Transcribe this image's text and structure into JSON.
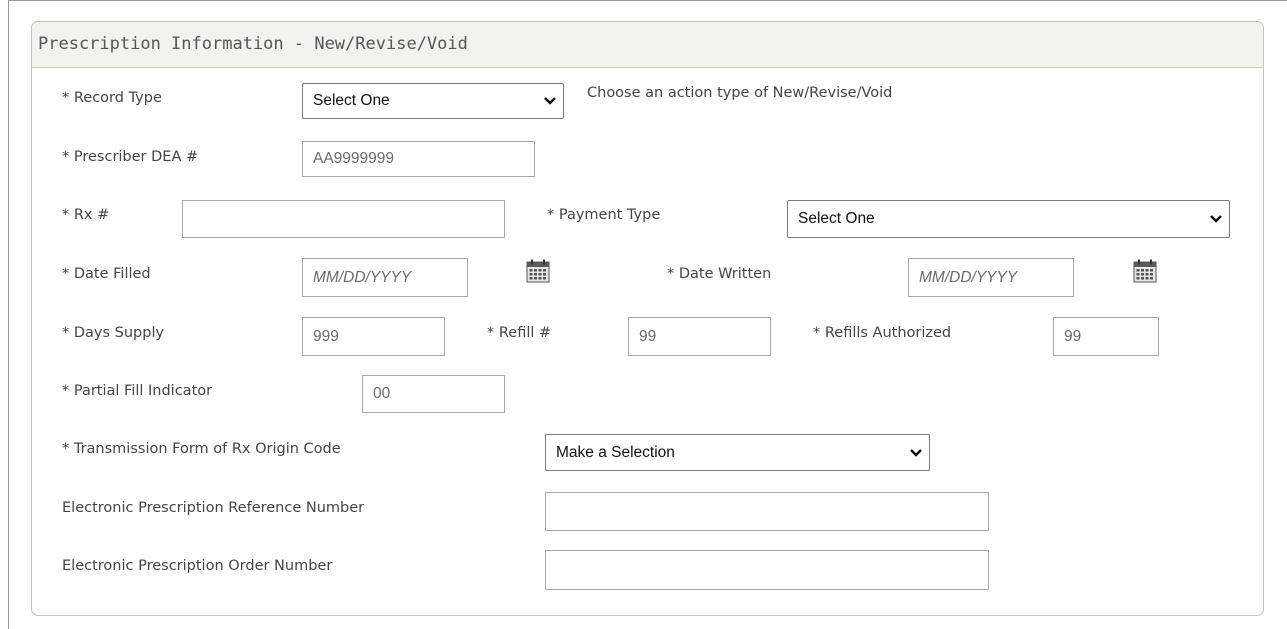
{
  "panel": {
    "title": "Prescription Information - New/Revise/Void"
  },
  "record_type": {
    "label": "* Record Type",
    "value": "Select One",
    "hint": "Choose an action type of New/Revise/Void"
  },
  "prescriber_dea": {
    "label": "* Prescriber DEA #",
    "placeholder": "AA9999999"
  },
  "rx_number": {
    "label": "* Rx #",
    "value": ""
  },
  "payment_type": {
    "label": "* Payment Type",
    "value": "Select One"
  },
  "date_filled": {
    "label": "* Date Filled",
    "placeholder": "MM/DD/YYYY",
    "icon": "calendar-icon"
  },
  "date_written": {
    "label": "* Date Written",
    "placeholder": "MM/DD/YYYY",
    "icon": "calendar-icon"
  },
  "days_supply": {
    "label": "* Days Supply",
    "placeholder": "999"
  },
  "refill_number": {
    "label": "* Refill #",
    "placeholder": "99"
  },
  "refills_authorized": {
    "label": "* Refills Authorized",
    "placeholder": "99"
  },
  "partial_fill": {
    "label": "* Partial Fill Indicator",
    "placeholder": "00"
  },
  "transmission_form": {
    "label": "* Transmission Form of Rx Origin Code",
    "value": "Make a Selection"
  },
  "erx_reference": {
    "label": "Electronic Prescription Reference Number",
    "value": ""
  },
  "erx_order": {
    "label": "Electronic Prescription Order Number",
    "value": ""
  }
}
